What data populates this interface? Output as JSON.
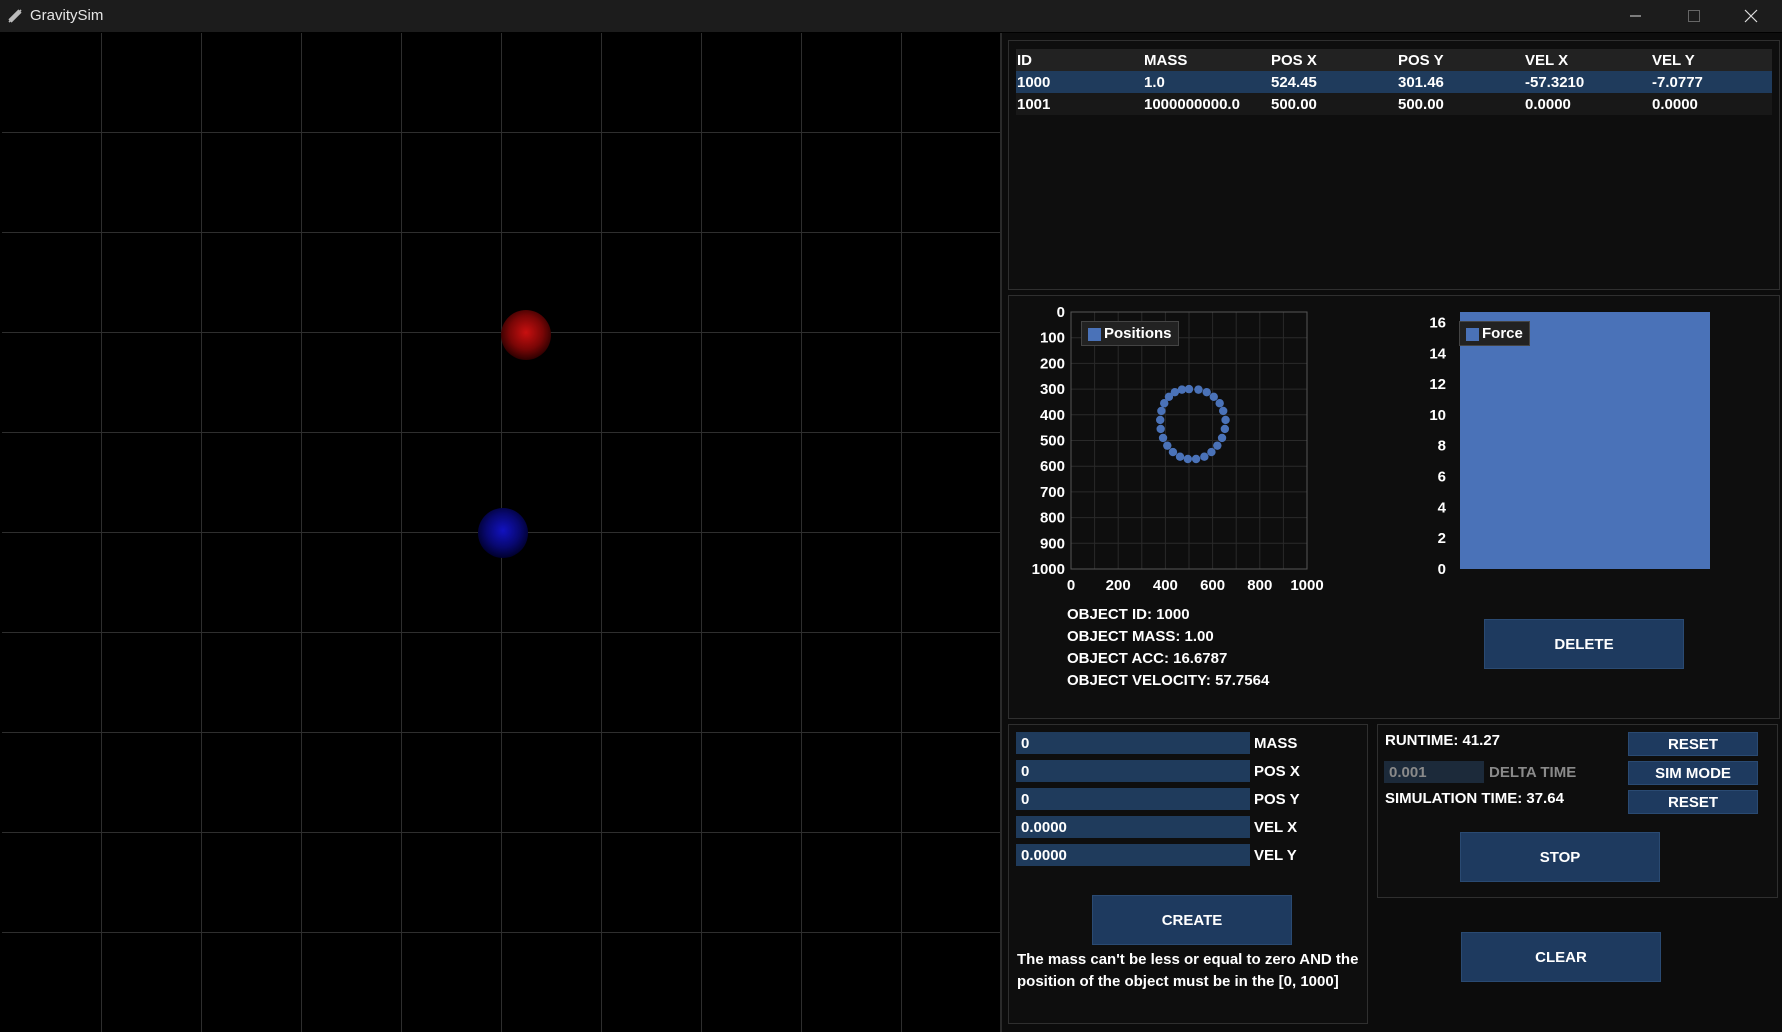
{
  "window": {
    "title": "GravitySim"
  },
  "table": {
    "headers": [
      "ID",
      "MASS",
      "POS X",
      "POS Y",
      "VEL X",
      "VEL Y"
    ],
    "rows": [
      [
        "1000",
        "1.0",
        "524.45",
        "301.46",
        "-57.3210",
        "-7.0777"
      ],
      [
        "1001",
        "1000000000.0",
        "500.00",
        "500.00",
        "0.0000",
        "0.0000"
      ]
    ],
    "selected_row": 0
  },
  "positions_chart": {
    "legend": "Positions",
    "x_ticks": [
      "0",
      "200",
      "400",
      "600",
      "800",
      "1000"
    ],
    "y_ticks": [
      "0",
      "100",
      "200",
      "300",
      "400",
      "500",
      "600",
      "700",
      "800",
      "900",
      "1000"
    ]
  },
  "force_chart": {
    "legend": "Force",
    "y_ticks": [
      "0",
      "2",
      "4",
      "6",
      "8",
      "10",
      "12",
      "14",
      "16"
    ]
  },
  "chart_data": [
    {
      "type": "scatter",
      "series": [
        {
          "name": "Positions",
          "points": [
            [
              500,
              300
            ],
            [
              540,
              302
            ],
            [
              575,
              312
            ],
            [
              605,
              330
            ],
            [
              630,
              355
            ],
            [
              645,
              385
            ],
            [
              655,
              420
            ],
            [
              652,
              455
            ],
            [
              640,
              490
            ],
            [
              620,
              520
            ],
            [
              595,
              545
            ],
            [
              565,
              563
            ],
            [
              530,
              572
            ],
            [
              495,
              572
            ],
            [
              462,
              563
            ],
            [
              432,
              545
            ],
            [
              408,
              520
            ],
            [
              390,
              490
            ],
            [
              380,
              455
            ],
            [
              378,
              420
            ],
            [
              383,
              385
            ],
            [
              395,
              355
            ],
            [
              415,
              330
            ],
            [
              440,
              312
            ],
            [
              470,
              302
            ]
          ]
        }
      ],
      "xlim": [
        0,
        1000
      ],
      "ylim": [
        0,
        1000
      ],
      "y_inverted": true,
      "grid": true,
      "legend_position": "top-left"
    },
    {
      "type": "bar",
      "series": [
        {
          "name": "Force",
          "values": [
            16.6787
          ]
        }
      ],
      "ylim": [
        0,
        16.6787
      ],
      "grid": false,
      "legend_position": "top-left"
    }
  ],
  "object_info": {
    "id": "OBJECT ID: 1000",
    "mass": "OBJECT MASS: 1.00",
    "acc": "OBJECT ACC: 16.6787",
    "velocity": "OBJECT VELOCITY: 57.7564"
  },
  "buttons": {
    "delete": "DELETE",
    "create": "CREATE",
    "reset_runtime": "RESET",
    "sim_mode": "SIM MODE",
    "reset_sim": "RESET",
    "stop": "STOP",
    "clear": "CLEAR"
  },
  "create_form": {
    "mass": {
      "value": "0",
      "label": "MASS"
    },
    "pos_x": {
      "value": "0",
      "label": "POS X"
    },
    "pos_y": {
      "value": "0",
      "label": "POS Y"
    },
    "vel_x": {
      "value": "0.0000",
      "label": "VEL X"
    },
    "vel_y": {
      "value": "0.0000",
      "label": "VEL Y"
    },
    "error": "The mass can't be less or equal to zero AND the position of the object must be in the [0, 1000]"
  },
  "time": {
    "runtime": "RUNTIME: 41.27",
    "delta_value": "0.001",
    "delta_label": "DELTA TIME",
    "simulation_time": "SIMULATION TIME: 37.64"
  },
  "colors": {
    "accent": "#1e3a5f",
    "series": "#4a72b8",
    "selected_row": "#1f3b5c"
  },
  "icons": [
    "app-icon",
    "minimize-icon",
    "maximize-icon",
    "close-icon"
  ]
}
